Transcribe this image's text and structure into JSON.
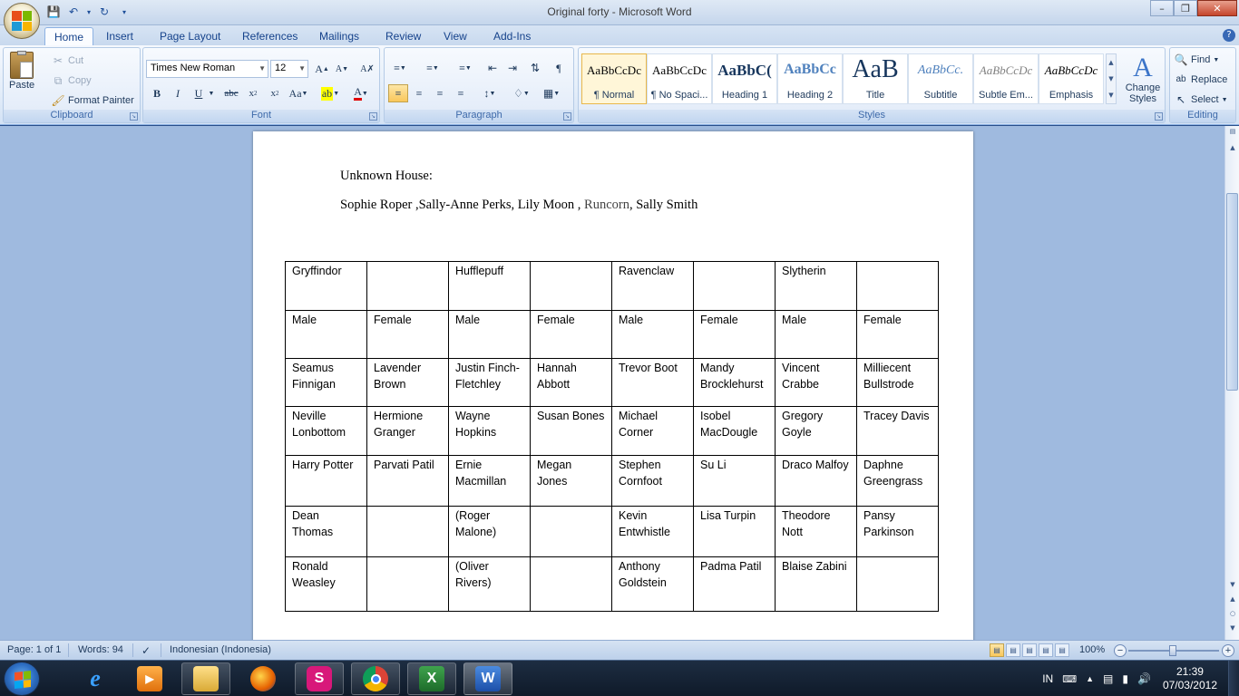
{
  "window": {
    "title": "Original forty - Microsoft Word"
  },
  "ribbon_tabs": [
    "Home",
    "Insert",
    "Page Layout",
    "References",
    "Mailings",
    "Review",
    "View",
    "Add-Ins"
  ],
  "clipboard": {
    "paste": "Paste",
    "cut": "Cut",
    "copy": "Copy",
    "format_painter": "Format Painter",
    "label": "Clipboard"
  },
  "font": {
    "name": "Times New Roman",
    "size": "12",
    "label": "Font"
  },
  "paragraph": {
    "label": "Paragraph"
  },
  "styles": {
    "items": [
      {
        "sample": "AaBbCcDc",
        "name": "¶ Normal"
      },
      {
        "sample": "AaBbCcDc",
        "name": "¶ No Spaci..."
      },
      {
        "sample": "AaBbC(",
        "name": "Heading 1"
      },
      {
        "sample": "AaBbCc",
        "name": "Heading 2"
      },
      {
        "sample": "AaB",
        "name": "Title"
      },
      {
        "sample": "AaBbCc.",
        "name": "Subtitle"
      },
      {
        "sample": "AaBbCcDc",
        "name": "Subtle Em..."
      },
      {
        "sample": "AaBbCcDc",
        "name": "Emphasis"
      }
    ],
    "change_styles": "Change Styles",
    "label": "Styles"
  },
  "editing": {
    "find": "Find",
    "replace": "Replace",
    "select": "Select",
    "label": "Editing"
  },
  "document": {
    "heading": "Unknown House:",
    "names_line_part1": "Sophie Roper ,Sally-Anne Perks, Lily Moon , ",
    "names_line_runcorn": "Runcorn",
    "names_line_part2": ", Sally Smith",
    "table": [
      [
        "Gryffindor",
        "",
        "Hufflepuff",
        "",
        "Ravenclaw",
        "",
        "Slytherin",
        ""
      ],
      [
        "Male",
        "Female",
        "Male",
        "Female",
        "Male",
        "Female",
        "Male",
        "Female"
      ],
      [
        "Seamus Finnigan",
        "Lavender Brown",
        "Justin Finch-Fletchley",
        "Hannah Abbott",
        "Trevor Boot",
        "Mandy Brocklehurst",
        "Vincent Crabbe",
        "Milliecent Bullstrode"
      ],
      [
        "Neville Lonbottom",
        "Hermione Granger",
        "Wayne Hopkins",
        "Susan Bones",
        "Michael Corner",
        "Isobel MacDougle",
        "Gregory Goyle",
        "Tracey Davis"
      ],
      [
        "Harry Potter",
        "Parvati Patil",
        "Ernie Macmillan",
        "Megan Jones",
        "Stephen Cornfoot",
        "Su Li",
        "Draco Malfoy",
        "Daphne Greengrass"
      ],
      [
        "Dean Thomas",
        "",
        "(Roger Malone)",
        "",
        "Kevin Entwhistle",
        "Lisa Turpin",
        "Theodore Nott",
        "Pansy Parkinson"
      ],
      [
        "Ronald Weasley",
        "",
        "(Oliver Rivers)",
        "",
        "Anthony Goldstein",
        "Padma Patil",
        "Blaise Zabini",
        ""
      ]
    ]
  },
  "statusbar": {
    "page": "Page: 1 of 1",
    "words": "Words: 94",
    "language": "Indonesian (Indonesia)",
    "zoom": "100%"
  },
  "taskbar": {
    "language": "IN",
    "time": "21:39",
    "date": "07/03/2012"
  },
  "colors": {
    "accent": "#15428b",
    "doc_background": "#9fbadf",
    "taskbar": "#0f1a29"
  }
}
